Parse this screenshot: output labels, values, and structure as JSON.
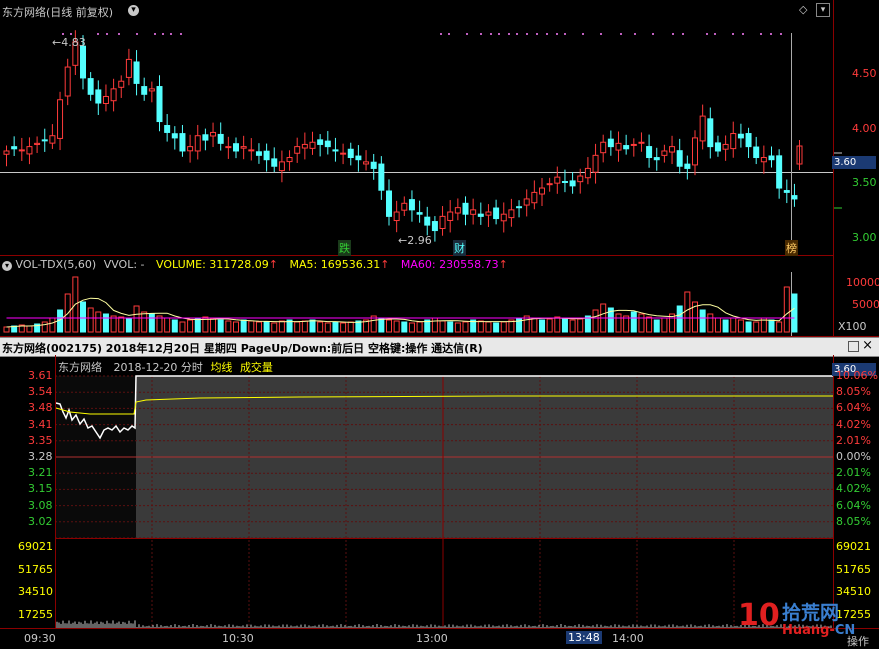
{
  "top_chart": {
    "title": "东方网络(日线 前复权)",
    "high_label": "4.83",
    "low_label": "2.96",
    "last_price": "3.60",
    "y_axis": [
      "4.50",
      "4.00",
      "3.50",
      "3.00"
    ],
    "markers": [
      "跌",
      "财",
      "榜"
    ]
  },
  "volume_bar": {
    "indicator": "VOL-TDX(5,60)",
    "vvol": "VVOL: -",
    "volume": "VOLUME: 311728.09",
    "ma5": "MA5: 169536.31",
    "ma60": "MA60: 230558.73",
    "arrow": "↑",
    "y_axis": [
      "10000",
      "5000"
    ],
    "multiplier": "X100"
  },
  "window": {
    "title": "东方网络(002175)  2018年12月20日 星期四  PageUp/Down:前后日 空格键:操作 通达信(R)"
  },
  "intraday": {
    "name": "东方网络",
    "date_label": "2018-12-20 分时",
    "avg_label": "均线",
    "vol_label": "成交量",
    "current_price": "3.60",
    "left_axis": [
      "3.61",
      "3.54",
      "3.48",
      "3.41",
      "3.35",
      "3.28",
      "3.21",
      "3.15",
      "3.08",
      "3.02"
    ],
    "right_axis": [
      "10.06%",
      "8.05%",
      "6.04%",
      "4.02%",
      "2.01%",
      "0.00%",
      "2.01%",
      "4.02%",
      "6.04%",
      "8.05%"
    ],
    "vol_axis": [
      "69021",
      "51765",
      "34510",
      "17255"
    ],
    "time_axis": [
      "09:30",
      "10:30",
      "13:00",
      "14:00"
    ],
    "cursor_time": "13:48",
    "watermark_num": "10",
    "watermark_text": "拾荒网",
    "watermark_url": "Huang-",
    "watermark_cn": "CN",
    "ops_label": "操作"
  },
  "colors": {
    "up": "#ff3b3b",
    "down": "#54ffff",
    "grid": "#8b0000",
    "yellow": "#ffff00",
    "magenta": "#ff00ff"
  }
}
